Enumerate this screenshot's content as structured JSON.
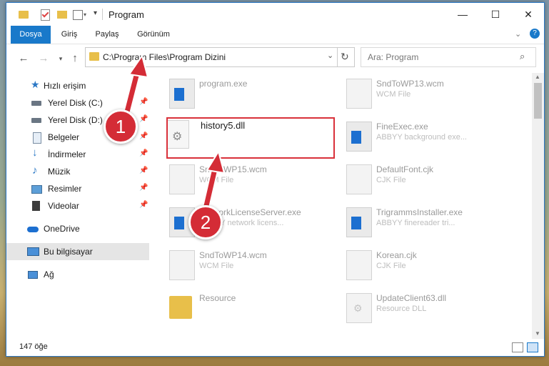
{
  "window": {
    "title": "Program"
  },
  "ribbon": {
    "tabs": [
      "Dosya",
      "Giriş",
      "Paylaş",
      "Görünüm"
    ]
  },
  "address": {
    "path": "C:\\Program Files\\Program Dizini"
  },
  "search": {
    "placeholder": "Ara: Program"
  },
  "navpane": {
    "items": [
      {
        "label": "Hızlı erişim",
        "icon": "star-icon",
        "pinned": false
      },
      {
        "label": "Yerel Disk (C:)",
        "icon": "drive-icon",
        "pinned": true
      },
      {
        "label": "Yerel Disk (D:)",
        "icon": "drive-icon",
        "pinned": true
      },
      {
        "label": "Belgeler",
        "icon": "documents-icon",
        "pinned": true
      },
      {
        "label": "İndirmeler",
        "icon": "download-icon",
        "pinned": true
      },
      {
        "label": "Müzik",
        "icon": "music-icon",
        "pinned": true
      },
      {
        "label": "Resimler",
        "icon": "pictures-icon",
        "pinned": true
      },
      {
        "label": "Videolar",
        "icon": "videos-icon",
        "pinned": true
      },
      {
        "label": "OneDrive",
        "icon": "cloud-icon",
        "pinned": false
      },
      {
        "label": "Bu bilgisayar",
        "icon": "computer-icon",
        "pinned": false
      },
      {
        "label": "Ağ",
        "icon": "network-icon",
        "pinned": false
      }
    ]
  },
  "files": {
    "left": [
      {
        "name": "program.exe",
        "desc": ""
      },
      {
        "name": "history5.dll",
        "desc": ""
      },
      {
        "name": "SndToWP15.wcm",
        "desc": "WCM File"
      },
      {
        "name": "NetworkLicenseServer.exe",
        "desc": "ABBYY network licens..."
      },
      {
        "name": "SndToWP14.wcm",
        "desc": "WCM File"
      },
      {
        "name": "Resource",
        "desc": ""
      }
    ],
    "right": [
      {
        "name": "SndToWP13.wcm",
        "desc": "WCM File"
      },
      {
        "name": "FineExec.exe",
        "desc": "ABBYY background exe..."
      },
      {
        "name": "DefaultFont.cjk",
        "desc": "CJK File"
      },
      {
        "name": "TrigrammsInstaller.exe",
        "desc": "ABBYY finereader tri..."
      },
      {
        "name": "Korean.cjk",
        "desc": "CJK File"
      },
      {
        "name": "UpdateClient63.dll",
        "desc": "Resource DLL"
      }
    ]
  },
  "status": {
    "count": "147 öğe"
  },
  "annotations": {
    "step1": "1",
    "step2": "2",
    "color": "#d42c36"
  }
}
